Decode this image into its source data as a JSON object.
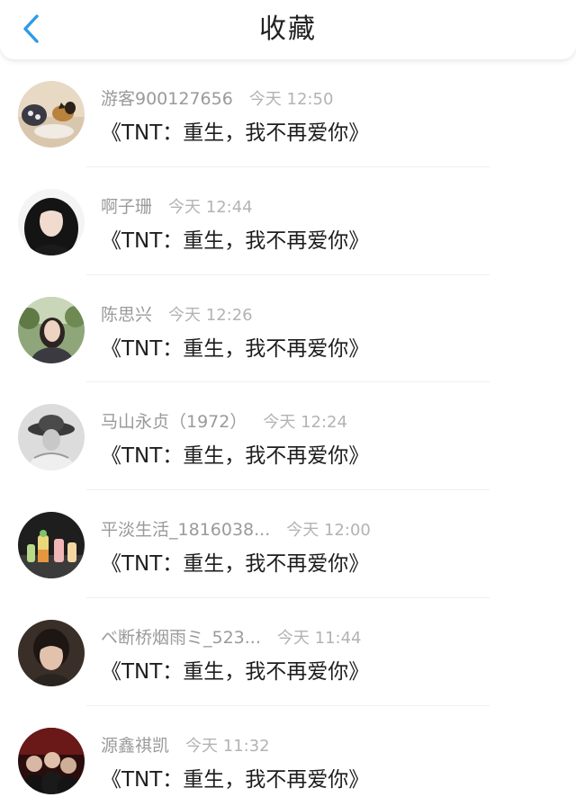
{
  "header": {
    "title": "收藏",
    "back_icon": "chevron-left-icon",
    "accent_color": "#2d9be8"
  },
  "items": [
    {
      "username": "游客900127656",
      "time": "今天 12:50",
      "book": "《TNT：重生，我不再爱你》",
      "avatar": "avatar-dog"
    },
    {
      "username": "啊子珊",
      "time": "今天 12:44",
      "book": "《TNT：重生，我不再爱你》",
      "avatar": "avatar-girl-dark-hair"
    },
    {
      "username": "陈思兴",
      "time": "今天 12:26",
      "book": "《TNT：重生，我不再爱你》",
      "avatar": "avatar-girl-outdoor"
    },
    {
      "username": "马山永贞（1972）",
      "time": "今天 12:24",
      "book": "《TNT：重生，我不再爱你》",
      "avatar": "avatar-hat-grayscale"
    },
    {
      "username": "平淡生活_1816038...",
      "time": "今天 12:00",
      "book": "《TNT：重生，我不再爱你》",
      "avatar": "avatar-drinks"
    },
    {
      "username": "ベ断桥烟雨ミ_523...",
      "time": "今天 11:44",
      "book": "《TNT：重生，我不再爱你》",
      "avatar": "avatar-boy-portrait"
    },
    {
      "username": "源鑫祺凯",
      "time": "今天 11:32",
      "book": "《TNT：重生，我不再爱你》",
      "avatar": "avatar-group-red"
    }
  ]
}
